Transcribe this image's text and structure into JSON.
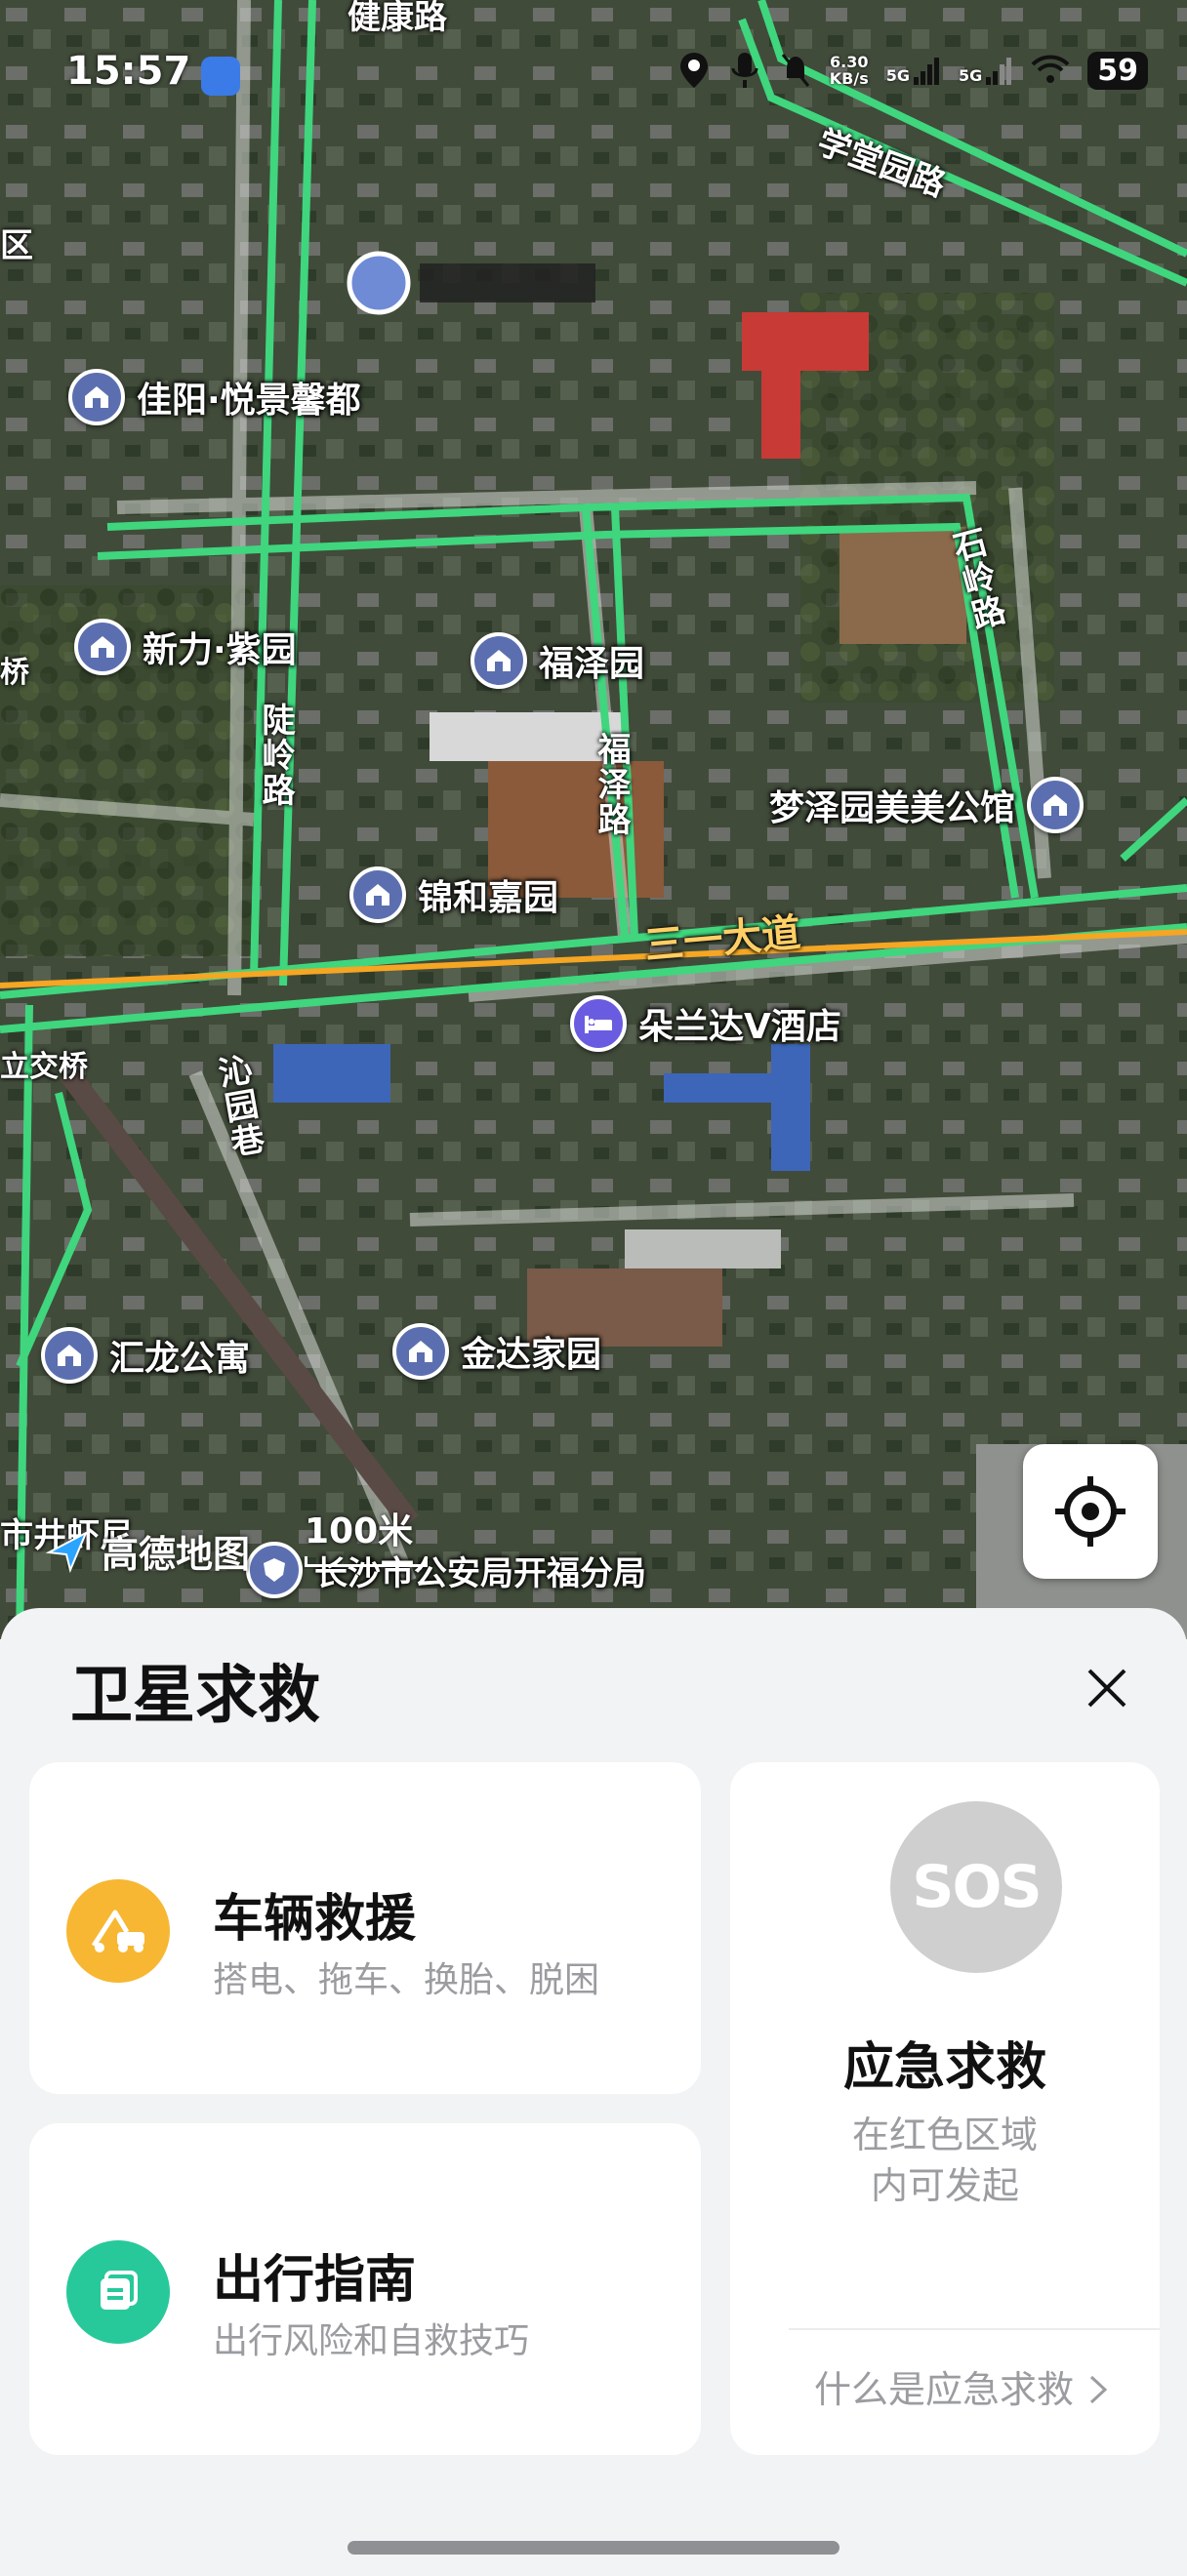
{
  "status_bar": {
    "time": "15:57",
    "net_speed": "6.30",
    "net_unit": "KB/s",
    "sig1": "5G",
    "sig2": "5G",
    "battery": "59",
    "icons": [
      "location-icon",
      "mic-icon",
      "mute-icon",
      "signal-icon",
      "signal-icon",
      "wifi-icon",
      "battery-icon"
    ]
  },
  "map": {
    "poi": [
      {
        "label": "佳阳·悦景馨都",
        "icon": "building-icon"
      },
      {
        "label": "新力·紫园",
        "icon": "building-icon"
      },
      {
        "label": "福泽园",
        "icon": "building-icon"
      },
      {
        "label": "梦泽园美美公馆",
        "icon": "building-icon"
      },
      {
        "label": "锦和嘉园",
        "icon": "building-icon"
      },
      {
        "label": "朵兰达V酒店",
        "icon": "hotel-icon"
      },
      {
        "label": "汇龙公寓",
        "icon": "building-icon"
      },
      {
        "label": "金达家园",
        "icon": "building-icon"
      },
      {
        "label": "长沙市公安局开福分局",
        "icon": "police-icon"
      }
    ],
    "roads": {
      "jiankang": "健康路",
      "xuetangyuan": "学堂园路",
      "shiling": "石岭路",
      "luling": "陡岭路",
      "fuze": "福泽路",
      "sanyi": "三一大道",
      "qinyuan": "沁园巷",
      "li_jiaoqiao": "立交桥",
      "qiao": "桥",
      "qu": "区",
      "shi_fragment": "市井虾尼"
    },
    "attribution": "高德地图",
    "scale": "100米"
  },
  "sheet": {
    "title": "卫星求救",
    "vehicle": {
      "title": "车辆救援",
      "subtitle": "搭电、拖车、换胎、脱困"
    },
    "guide": {
      "title": "出行指南",
      "subtitle": "出行风险和自救技巧"
    },
    "sos": {
      "badge": "SOS",
      "title": "应急求救",
      "desc_line1": "在红色区域",
      "desc_line2": "内可发起",
      "link": "什么是应急求救"
    }
  },
  "colors": {
    "road_green": "#3fd67e",
    "road_orange": "#f5a623",
    "vehicle_icon": "#f7b733",
    "guide_icon": "#27c99a",
    "sos_gray": "#cfcfcf"
  }
}
